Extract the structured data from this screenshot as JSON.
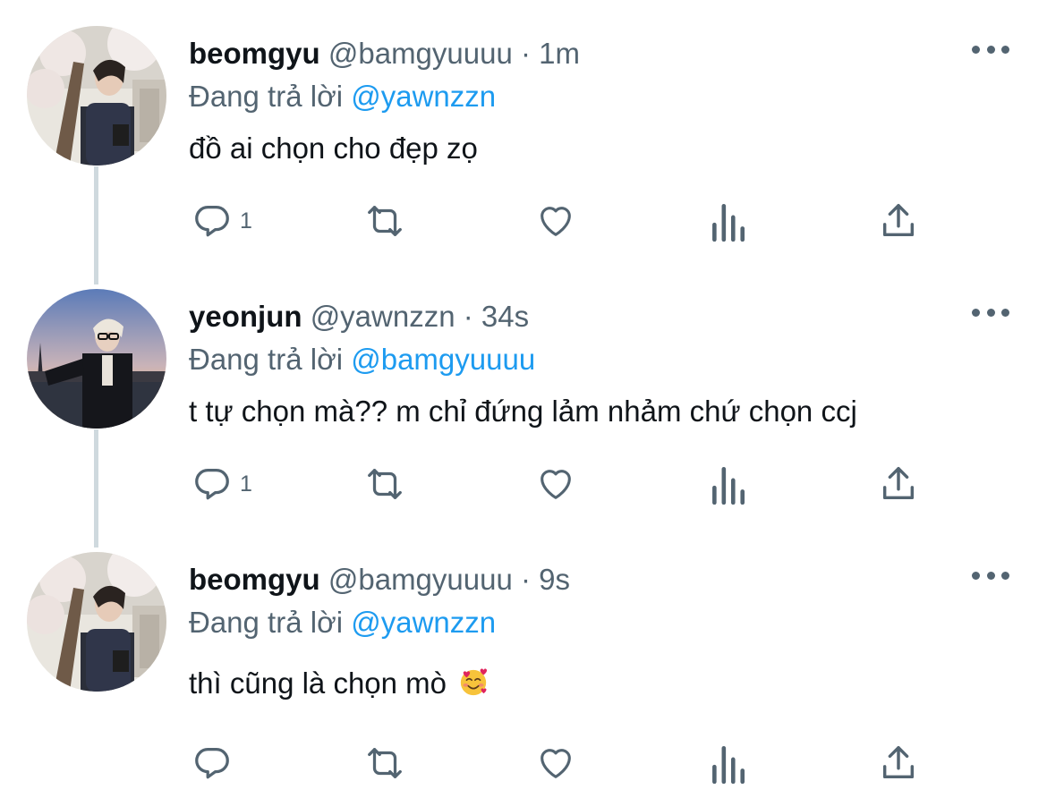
{
  "tweets": [
    {
      "display_name": "beomgyu",
      "handle": "@bamgyuuuu",
      "separator": " · ",
      "time": "1m",
      "replying_prefix": "Đang trả lời ",
      "replying_to": "@yawnzzn",
      "text": "đồ ai chọn cho đẹp zọ",
      "reply_count": "1",
      "avatar": "cherry-blossom-photo"
    },
    {
      "display_name": "yeonjun",
      "handle": "@yawnzzn",
      "separator": " · ",
      "time": "34s",
      "replying_prefix": "Đang trả lời ",
      "replying_to": "@bamgyuuuu",
      "text": "t tự chọn mà?? m chỉ đứng lảm nhảm chứ chọn ccj",
      "reply_count": "1",
      "avatar": "paris-dusk-photo"
    },
    {
      "display_name": "beomgyu",
      "handle": "@bamgyuuuu",
      "separator": " · ",
      "time": "9s",
      "replying_prefix": "Đang trả lời ",
      "replying_to": "@yawnzzn",
      "text": "thì cũng là chọn mò",
      "reply_count": "",
      "avatar": "cherry-blossom-photo",
      "emoji": "smiling-face-with-hearts"
    }
  ],
  "icons": {
    "reply": "reply-icon",
    "retweet": "retweet-icon",
    "like": "heart-icon",
    "views": "views-icon",
    "share": "share-icon",
    "more": "more-icon"
  },
  "colors": {
    "text": "#0f1419",
    "secondary": "#536471",
    "link": "#1d9bf0",
    "thread_line": "#cfd9de"
  }
}
